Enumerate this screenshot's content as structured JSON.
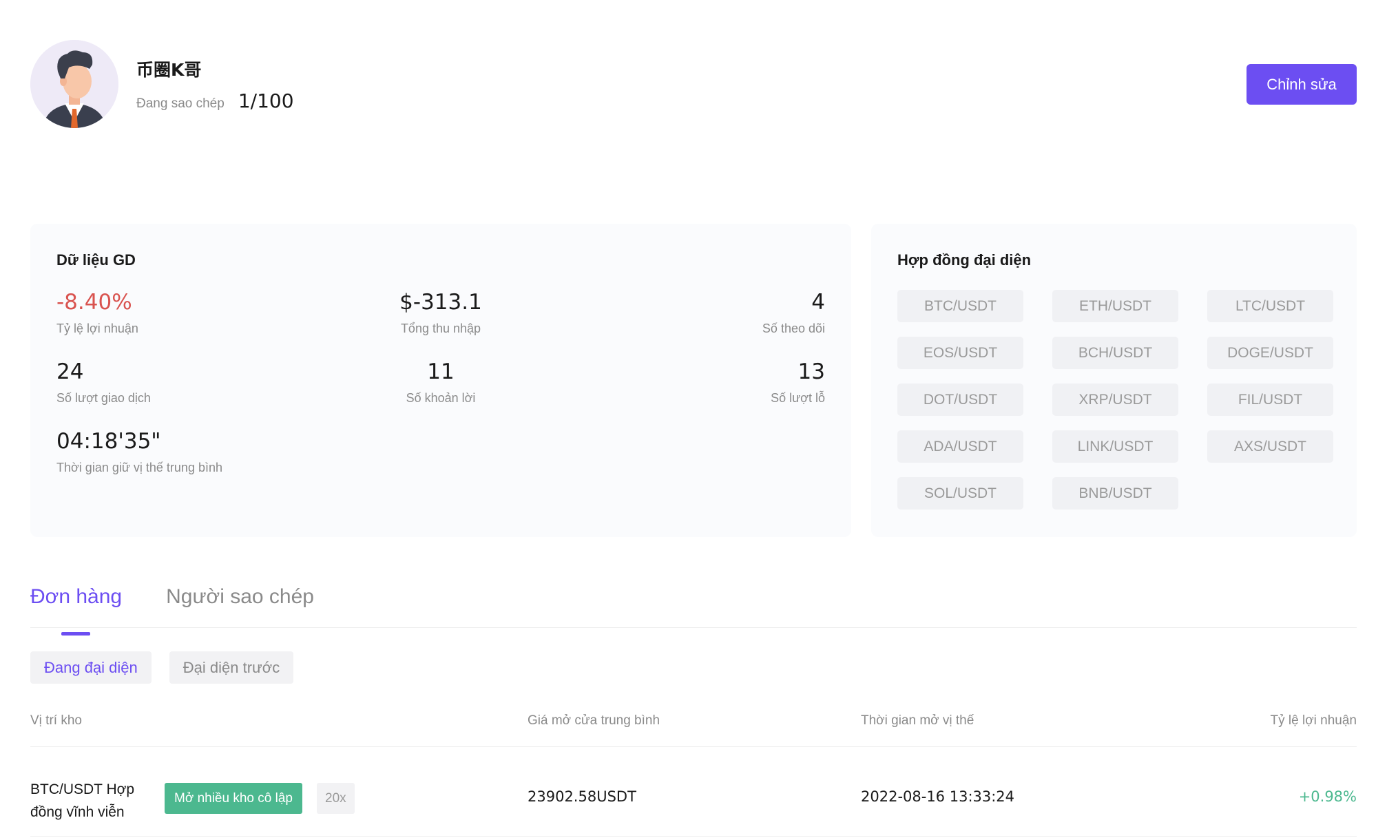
{
  "profile": {
    "name": "币圈K哥",
    "copy_label": "Đang sao chép",
    "copy_value": "1/100",
    "edit_label": "Chỉnh sửa"
  },
  "trading_data": {
    "title": "Dữ liệu GD",
    "stats": [
      {
        "value": "-8.40%",
        "label": "Tỷ lệ lợi nhuận"
      },
      {
        "value": "$-313.1",
        "label": "Tổng thu nhập"
      },
      {
        "value": "4",
        "label": "Số theo dõi"
      },
      {
        "value": "24",
        "label": "Số lượt giao dịch"
      },
      {
        "value": "11",
        "label": "Số khoản lời"
      },
      {
        "value": "13",
        "label": "Số lượt lỗ"
      },
      {
        "value": "04:18'35\"",
        "label": "Thời gian giữ vị thế trung bình"
      }
    ]
  },
  "contracts": {
    "title": "Hợp đồng đại diện",
    "items": [
      "BTC/USDT",
      "ETH/USDT",
      "LTC/USDT",
      "EOS/USDT",
      "BCH/USDT",
      "DOGE/USDT",
      "DOT/USDT",
      "XRP/USDT",
      "FIL/USDT",
      "ADA/USDT",
      "LINK/USDT",
      "AXS/USDT",
      "SOL/USDT",
      "BNB/USDT"
    ]
  },
  "tabs": {
    "orders": "Đơn hàng",
    "copiers": "Người sao chép"
  },
  "subtabs": {
    "current": "Đang đại diện",
    "previous": "Đại diện trước"
  },
  "table": {
    "headers": {
      "position": "Vị trí kho",
      "avg_price": "Giá mở cửa trung bình",
      "open_time": "Thời gian mở vị thế",
      "profit_rate": "Tỷ lệ lợi nhuận"
    },
    "rows": [
      {
        "pair_line1": "BTC/USDT Hợp",
        "pair_line2": "đồng vĩnh viễn",
        "mode": "Mở nhiều kho cô lập",
        "leverage": "20x",
        "avg_price": "23902.58USDT",
        "open_time": "2022-08-16 13:33:24",
        "profit_rate": "+0.98%"
      }
    ]
  },
  "colors": {
    "accent": "#6c4ef2",
    "negative": "#d9534f",
    "positive": "#4cb88f"
  }
}
